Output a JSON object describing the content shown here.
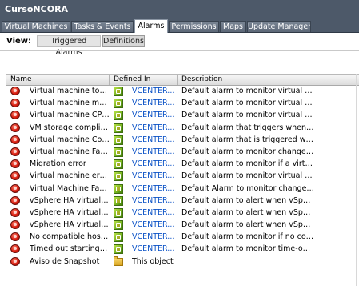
{
  "window": {
    "title": "CursoNCORA"
  },
  "tabs": [
    {
      "label": "Virtual Machines",
      "active": false
    },
    {
      "label": "Tasks & Events",
      "active": false
    },
    {
      "label": "Alarms",
      "active": true
    },
    {
      "label": "Permissions",
      "active": false
    },
    {
      "label": "Maps",
      "active": false
    },
    {
      "label": "Update Manager",
      "active": false
    }
  ],
  "view": {
    "label": "View:",
    "buttons": [
      {
        "label": "Triggered Alarms",
        "selected": false
      },
      {
        "label": "Definitions",
        "selected": true
      }
    ]
  },
  "table": {
    "columns": [
      "Name",
      "Defined In",
      "Description"
    ],
    "rows": [
      {
        "name": "Virtual machine total...",
        "defined_in": "VCENTER...",
        "description": "Default alarm to monitor virtual mac..."
      },
      {
        "name": "Virtual machine me...",
        "defined_in": "VCENTER...",
        "description": "Default alarm to monitor virtual mac..."
      },
      {
        "name": "Virtual machine CPU...",
        "defined_in": "VCENTER...",
        "description": "Default alarm to monitor virtual mac..."
      },
      {
        "name": "VM storage complian...",
        "defined_in": "VCENTER...",
        "description": "Default alarm that triggers when the..."
      },
      {
        "name": "Virtual machine Con...",
        "defined_in": "VCENTER...",
        "description": "Default alarm that is triggered when..."
      },
      {
        "name": "Virtual machine Fault...",
        "defined_in": "VCENTER...",
        "description": "Default alarm to monitor changes in..."
      },
      {
        "name": "Migration error",
        "defined_in": "VCENTER...",
        "description": "Default alarm to monitor if a virtual..."
      },
      {
        "name": "Virtual machine error",
        "defined_in": "VCENTER...",
        "description": "Default alarm to monitor virtual mac..."
      },
      {
        "name": "Virtual Machine Fault...",
        "defined_in": "VCENTER...",
        "description": "Default Alarm to monitor changes in..."
      },
      {
        "name": "vSphere HA virtual ...",
        "defined_in": "VCENTER...",
        "description": "Default alarm to alert when vSphere..."
      },
      {
        "name": "vSphere HA virtual ...",
        "defined_in": "VCENTER...",
        "description": "Default alarm to alert when vSphere..."
      },
      {
        "name": "vSphere HA virtual ...",
        "defined_in": "VCENTER...",
        "description": "Default alarm to alert when vSphere..."
      },
      {
        "name": "No compatible host f...",
        "defined_in": "VCENTER...",
        "description": "Default alarm to monitor if no comp..."
      },
      {
        "name": "Timed out starting S...",
        "defined_in": "VCENTER...",
        "description": "Default alarm to monitor time-outs ..."
      },
      {
        "name": "Aviso de Snapshot",
        "defined_in": "This object",
        "description": ""
      }
    ]
  }
}
